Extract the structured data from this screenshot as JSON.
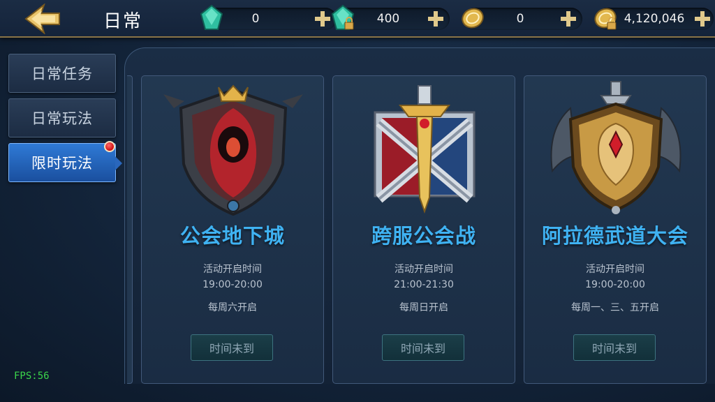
{
  "header": {
    "title": "日常"
  },
  "currencies": [
    {
      "icon": "green-gem-icon",
      "value": "0"
    },
    {
      "icon": "locked-gem-icon",
      "value": "400"
    },
    {
      "icon": "gold-coin-icon",
      "value": "0"
    },
    {
      "icon": "locked-coin-icon",
      "value": "4,120,046"
    }
  ],
  "sidebar": {
    "tabs": [
      {
        "label": "日常任务",
        "active": false
      },
      {
        "label": "日常玩法",
        "active": false
      },
      {
        "label": "限时玩法",
        "active": true,
        "badge": true
      }
    ]
  },
  "cards": [
    {
      "name": "公会地下城",
      "time_label": "活动开启时间",
      "time": "19:00-20:00",
      "schedule": "每周六开启",
      "button": "时间未到"
    },
    {
      "name": "跨服公会战",
      "time_label": "活动开启时间",
      "time": "21:00-21:30",
      "schedule": "每周日开启",
      "button": "时间未到"
    },
    {
      "name": "阿拉德武道大会",
      "time_label": "活动开启时间",
      "time": "19:00-20:00",
      "schedule": "每周一、三、五开启",
      "button": "时间未到"
    }
  ],
  "fps": "FPS:56",
  "colors": {
    "accent_blue": "#3fb2f2",
    "active_tab": "#2f7ad6",
    "gold": "#c9a54a",
    "fps_green": "#3bd54a"
  }
}
